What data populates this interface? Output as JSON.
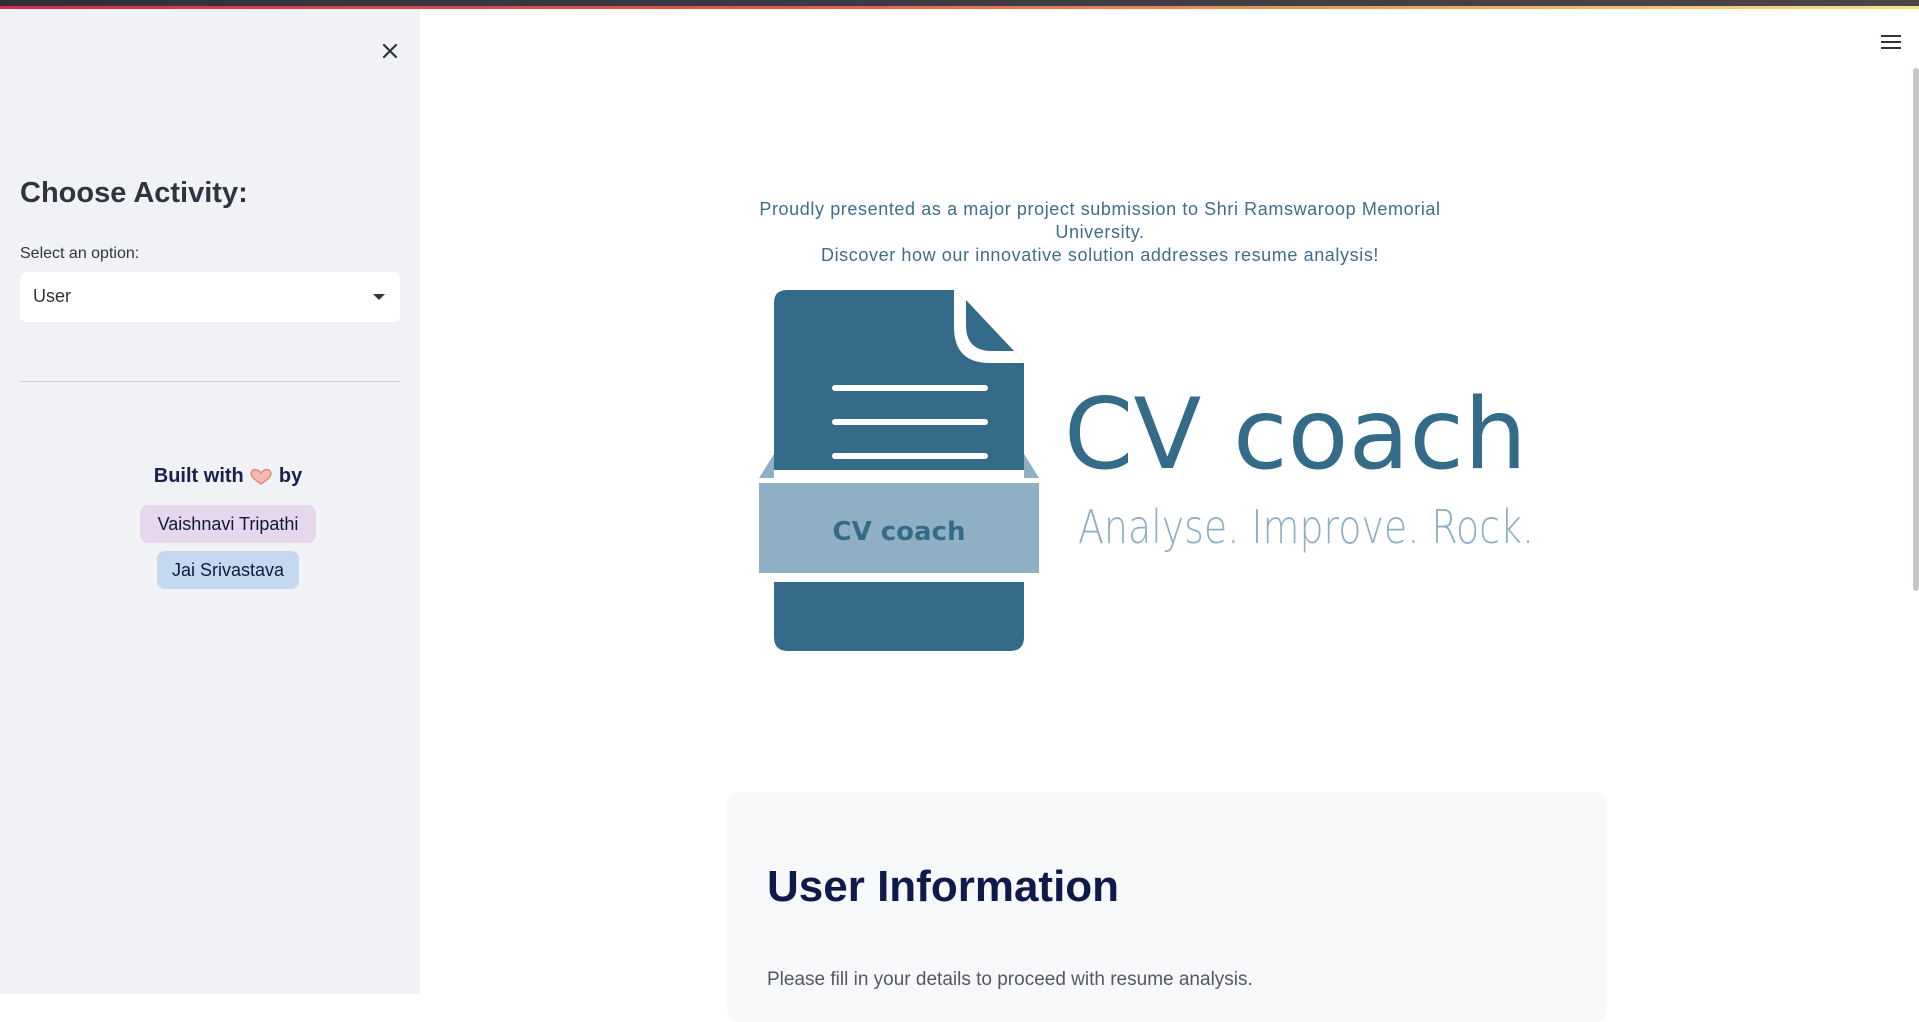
{
  "sidebar": {
    "title": "Choose Activity:",
    "select_label": "Select an option:",
    "select_value": "User",
    "built_with_prefix": "Built with",
    "built_with_suffix": "by",
    "authors": [
      "Vaishnavi Tripathi",
      "Jai Srivastava"
    ]
  },
  "main": {
    "tagline_line1": "Proudly presented as a major project submission to Shri Ramswaroop Memorial University.",
    "tagline_line2": "Discover how our innovative solution addresses resume analysis!",
    "logo": {
      "badge_text": "CV coach",
      "brand_name": "CV coach",
      "slogan": "Analyse. Improve. Rock."
    },
    "user_card": {
      "heading": "User Information",
      "description": "Please fill in your details to proceed with resume analysis."
    }
  },
  "colors": {
    "sidebar_bg": "#f0f2f6",
    "brand_dark": "#336b88",
    "brand_light": "#8eafc4",
    "heading_navy": "#0e1a4a"
  },
  "icons": [
    "close-icon",
    "heart-hands-icon",
    "chevron-down-icon",
    "hamburger-menu-icon",
    "document-icon"
  ]
}
